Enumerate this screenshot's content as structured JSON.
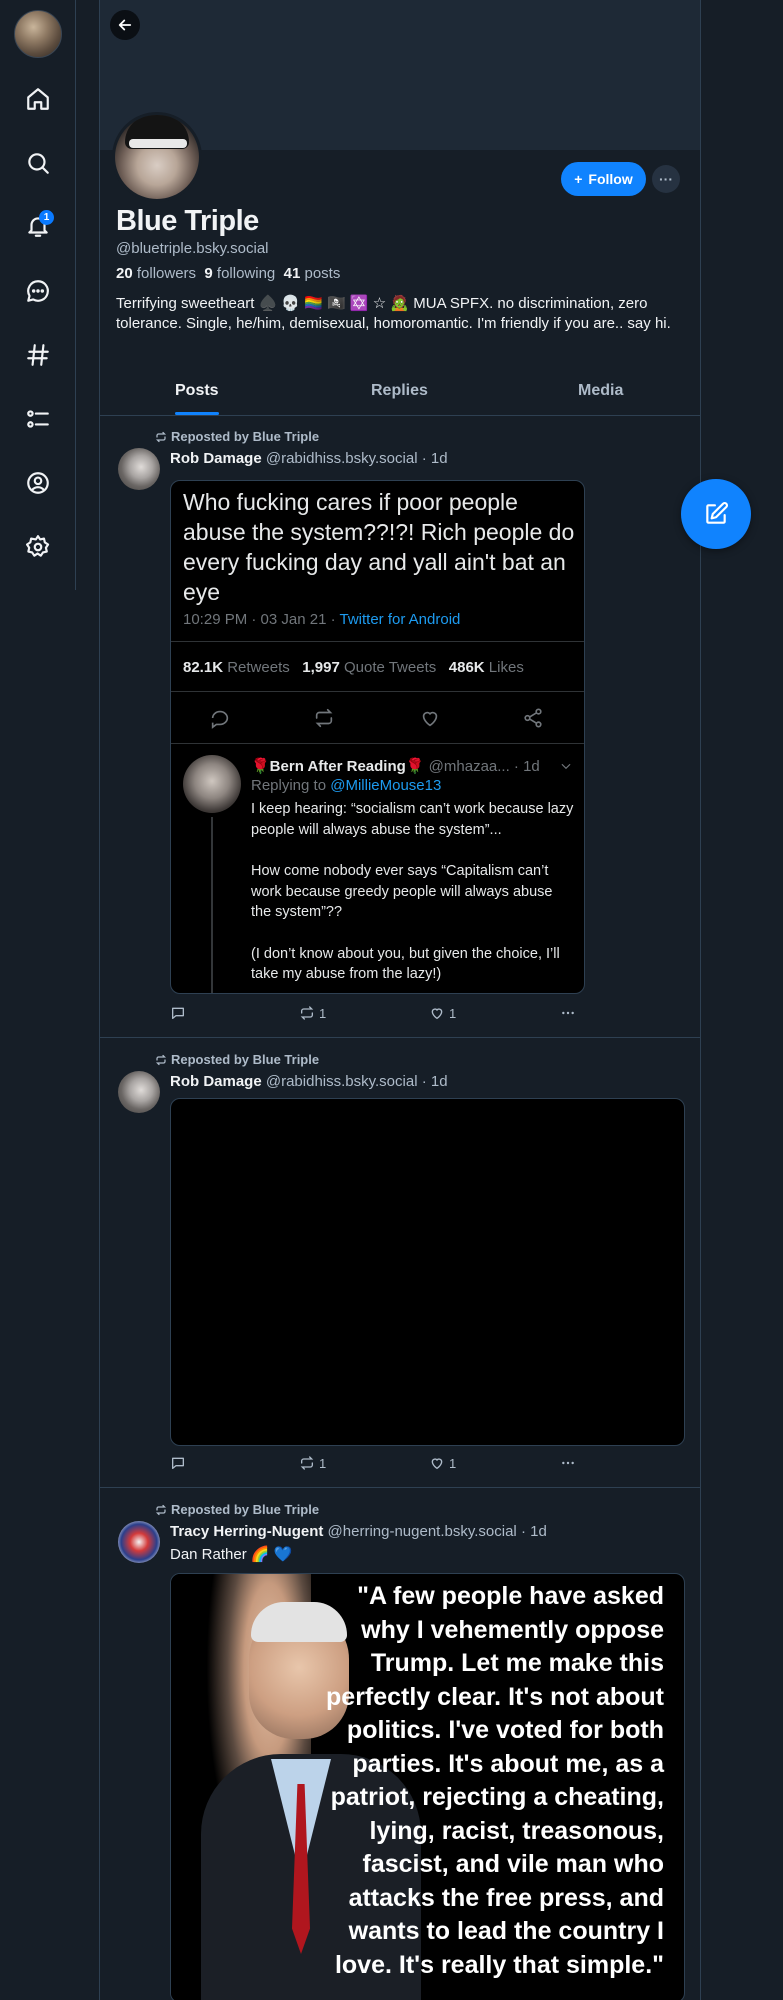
{
  "sidebar": {
    "items": [
      {
        "name": "home",
        "icon": "home-icon"
      },
      {
        "name": "search",
        "icon": "search-icon"
      },
      {
        "name": "notifications",
        "icon": "bell-icon",
        "badge": "1"
      },
      {
        "name": "chat",
        "icon": "chat-icon"
      },
      {
        "name": "feeds",
        "icon": "hashtag-icon"
      },
      {
        "name": "lists",
        "icon": "list-icon"
      },
      {
        "name": "profile",
        "icon": "user-circle-icon"
      },
      {
        "name": "settings",
        "icon": "gear-icon"
      }
    ]
  },
  "profile": {
    "display_name": "Blue Triple",
    "handle": "@bluetriple.bsky.social",
    "followers_count": "20",
    "followers_label": "followers",
    "following_count": "9",
    "following_label": "following",
    "posts_count": "41",
    "posts_label": "posts",
    "bio": "Terrifying sweetheart ♠️ 💀 🏳️‍🌈 🏴‍☠️ ✡️ ☆ 🧟 MUA SPFX. no discrimination, zero tolerance. Single, he/him, demisexual, homoromantic.  I'm friendly if you are.. say hi.",
    "follow_label": "Follow",
    "more_label": "···"
  },
  "tabs": [
    {
      "label": "Posts",
      "active": true
    },
    {
      "label": "Replies",
      "active": false
    },
    {
      "label": "Media",
      "active": false
    }
  ],
  "posts": [
    {
      "repost_label": "Reposted by Blue Triple",
      "author_name": "Rob Damage",
      "author_handle": "@rabidhiss.bsky.social",
      "time": "· 1d",
      "embed": {
        "text": "Who fucking cares if poor people abuse the system??!?! Rich people do every fucking day and yall ain't bat an eye",
        "meta_time": "10:29 PM · 03 Jan 21 · ",
        "meta_source": "Twitter for Android",
        "retweets_count": "82.1K",
        "retweets_label": "Retweets",
        "quotes_count": "1,997",
        "quotes_label": "Quote Tweets",
        "likes_count": "486K",
        "likes_label": "Likes",
        "reply_name": "🌹Bern After Reading🌹",
        "reply_handle": "@mhazaa...",
        "reply_time": "· 1d",
        "reply_to_label": "Replying to ",
        "reply_to_handle": "@MillieMouse13",
        "reply_p1": "I keep hearing: “socialism can’t work because lazy people will always abuse the system”...",
        "reply_p2": "How come nobody ever says “Capitalism can’t work because greedy people will always abuse the system”??",
        "reply_p3": "(I don’t know about you, but given the choice, I’ll take my abuse from the lazy!)"
      },
      "reposts": "1",
      "likes": "1"
    },
    {
      "repost_label": "Reposted by Blue Triple",
      "author_name": "Rob Damage",
      "author_handle": "@rabidhiss.bsky.social",
      "time": "· 1d",
      "reposts": "1",
      "likes": "1"
    },
    {
      "repost_label": "Reposted by Blue Triple",
      "author_name": "Tracy Herring-Nugent",
      "author_handle": "@herring-nugent.bsky.social",
      "time": "· 1d",
      "text": "Dan Rather 🌈 💙",
      "image_quote": "\"A few people have asked why I vehemently oppose Trump. Let me make this perfectly clear. It's not about politics. I've voted for both parties. It's about me, as a patriot, rejecting a cheating, lying, racist, treasonous, fascist, and vile man who attacks the free press, and wants to lead the country I love. It's really that simple.\""
    }
  ],
  "colors": {
    "background": "#161e27",
    "accent": "#1083fe",
    "muted_text": "#aebbc9",
    "border": "#2e4052"
  }
}
